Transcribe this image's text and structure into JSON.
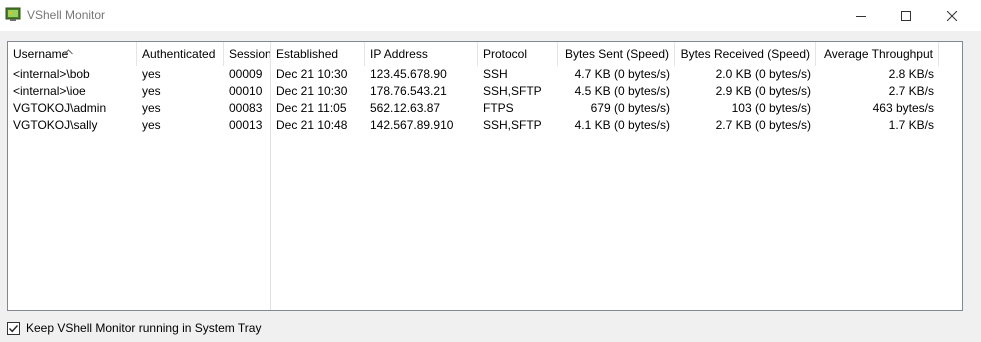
{
  "window": {
    "title": "VShell Monitor"
  },
  "columns": [
    {
      "key": "username",
      "label": "Username"
    },
    {
      "key": "authenticated",
      "label": "Authenticated"
    },
    {
      "key": "session",
      "label": "Session"
    },
    {
      "key": "established",
      "label": "Established"
    },
    {
      "key": "ip",
      "label": "IP Address"
    },
    {
      "key": "protocol",
      "label": "Protocol"
    },
    {
      "key": "bytes_sent",
      "label": "Bytes Sent (Speed)"
    },
    {
      "key": "bytes_received",
      "label": "Bytes Received (Speed)"
    },
    {
      "key": "avg_throughput",
      "label": "Average Throughput"
    }
  ],
  "rows": [
    {
      "username": "<internal>\\bob",
      "authenticated": "yes",
      "session": "00009",
      "established": "Dec 21 10:30",
      "ip": "123.45.678.90",
      "protocol": "SSH",
      "bytes_sent": "4.7 KB (0 bytes/s)",
      "bytes_received": "2.0 KB (0 bytes/s)",
      "avg_throughput": "2.8 KB/s"
    },
    {
      "username": "<internal>\\ioe",
      "authenticated": "yes",
      "session": "00010",
      "established": "Dec 21 10:30",
      "ip": "178.76.543.21",
      "protocol": "SSH,SFTP",
      "bytes_sent": "4.5 KB (0 bytes/s)",
      "bytes_received": "2.9 KB (0 bytes/s)",
      "avg_throughput": "2.7 KB/s"
    },
    {
      "username": "VGTOKOJ\\admin",
      "authenticated": "yes",
      "session": "00083",
      "established": "Dec 21 11:05",
      "ip": "562.12.63.87",
      "protocol": "FTPS",
      "bytes_sent": "679 (0 bytes/s)",
      "bytes_received": "103 (0 bytes/s)",
      "avg_throughput": "463 bytes/s"
    },
    {
      "username": "VGTOKOJ\\sally",
      "authenticated": "yes",
      "session": "00013",
      "established": "Dec 21 10:48",
      "ip": "142.567.89.910",
      "protocol": "SSH,SFTP",
      "bytes_sent": "4.1 KB (0 bytes/s)",
      "bytes_received": "2.7 KB (0 bytes/s)",
      "avg_throughput": "1.7 KB/s"
    }
  ],
  "sort": {
    "column": "username",
    "direction": "ascending"
  },
  "tray_option": {
    "label": "Keep VShell Monitor running in System Tray",
    "checked": true
  },
  "icons": {
    "app": "vshell-monitor-icon",
    "minimize": "minimize-icon",
    "maximize": "maximize-icon",
    "close": "close-icon"
  }
}
